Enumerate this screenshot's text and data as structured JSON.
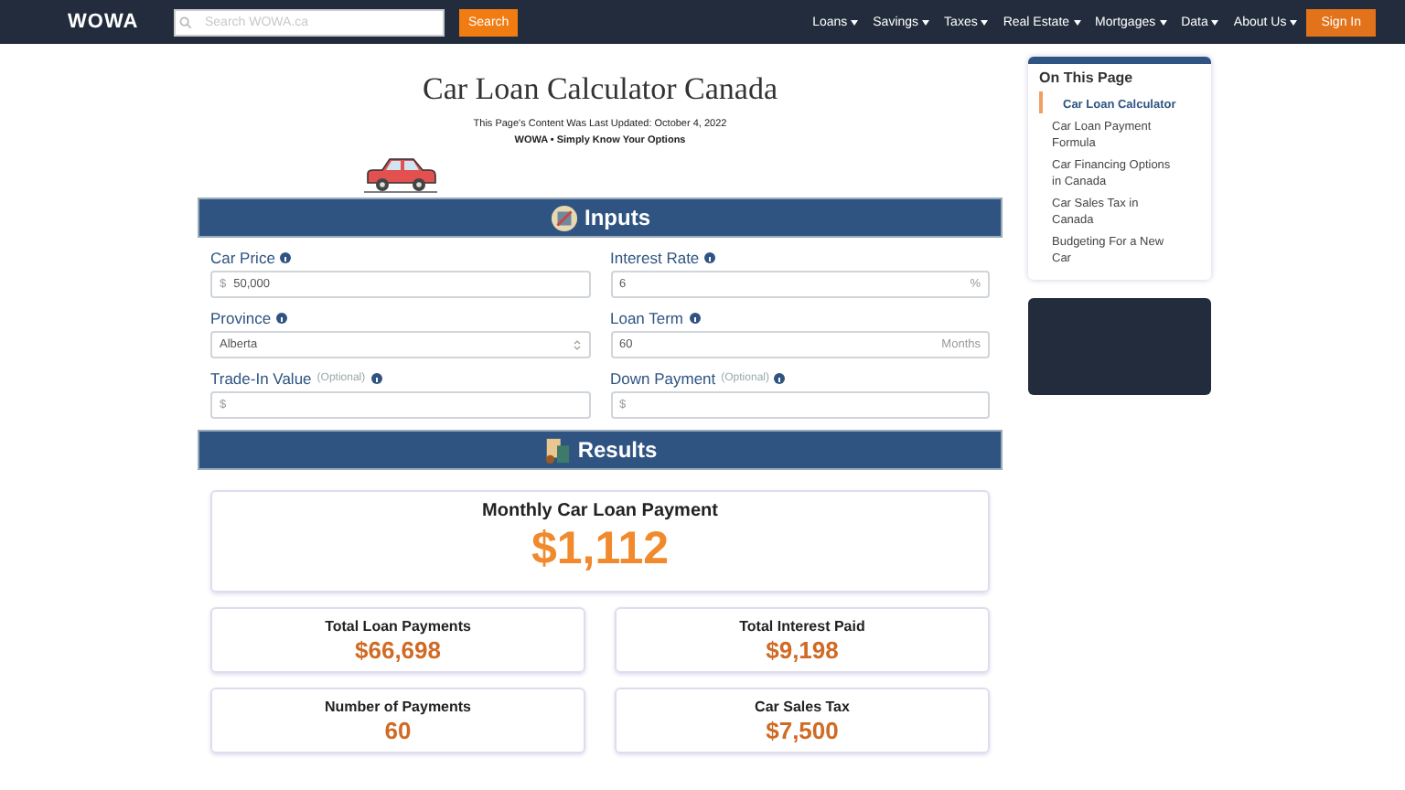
{
  "header": {
    "logo": "WOWA",
    "search": {
      "placeholder": "Search WOWA.ca"
    },
    "search_button": "Search",
    "menu": [
      "Loans",
      "Savings",
      "Taxes",
      "Real Estate",
      "Mortgages",
      "Data",
      "About Us"
    ],
    "sign_in": "Sign In"
  },
  "page": {
    "title": "Car Loan Calculator Canada",
    "updated": "This Page's Content Was Last Updated: October 4, 2022",
    "tagline": "WOWA • Simply Know Your Options"
  },
  "inputs": {
    "title": "Inputs",
    "fields": [
      {
        "kind": "text",
        "label": "Car Price",
        "prefix": "$",
        "value": "50,000"
      },
      {
        "kind": "text",
        "label": "Interest Rate",
        "value": "6",
        "suffix": "%"
      },
      {
        "kind": "select",
        "label": "Province",
        "value": "Alberta"
      },
      {
        "kind": "text",
        "label": "Loan Term",
        "value": "60",
        "suffix": "Months"
      },
      {
        "kind": "text",
        "label": "Trade-In Value",
        "optional": "(Optional)",
        "prefix": "$"
      },
      {
        "kind": "text",
        "label": "Down Payment",
        "optional": "(Optional)",
        "prefix": "$"
      }
    ]
  },
  "results": {
    "title": "Results",
    "main": {
      "label": "Monthly Car Loan Payment",
      "value": "$1,112"
    },
    "cards": [
      {
        "label": "Total Loan Payments",
        "value": "$66,698"
      },
      {
        "label": "Total Interest Paid",
        "value": "$9,198"
      },
      {
        "label": "Number of Payments",
        "value": "60"
      },
      {
        "label": "Car Sales Tax",
        "value": "$7,500"
      }
    ]
  },
  "sidebar": {
    "title": "On This Page",
    "items": [
      {
        "label": "Car Loan Calculator",
        "selected": true
      },
      {
        "label": "Car Loan Payment Formula",
        "selected": false
      },
      {
        "label": "Car Financing Options in Canada",
        "selected": false
      },
      {
        "label": "Car Sales Tax in Canada",
        "selected": false
      },
      {
        "label": "Budgeting For a New Car",
        "selected": false
      }
    ]
  }
}
